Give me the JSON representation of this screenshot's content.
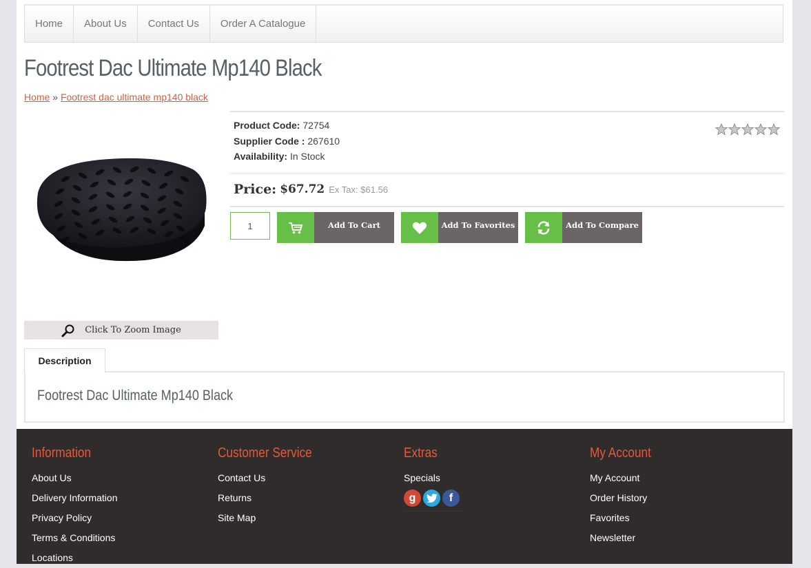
{
  "nav": {
    "items": [
      "Home",
      "About Us",
      "Contact Us",
      "Order A Catalogue"
    ]
  },
  "product": {
    "title": "Footrest Dac Ultimate Mp140 Black",
    "breadcrumb": {
      "home": "Home",
      "separator": "»",
      "current": "Footrest dac ultimate mp140 black"
    },
    "product_code_label": "Product Code:",
    "product_code": "72754",
    "supplier_code_label": "Supplier Code :",
    "supplier_code": "267610",
    "availability_label": "Availability:",
    "availability": "In Stock",
    "rating": 0,
    "rating_max": 5,
    "price_label": "Price:",
    "price": "$67.72",
    "ex_tax_label": "Ex Tax:",
    "ex_tax": "$61.56",
    "quantity": "1",
    "zoom_label": "Click To Zoom Image"
  },
  "buttons": {
    "add_to_cart": "Add To Cart",
    "add_to_favorites": "Add To Favorites",
    "add_to_compare": "Add To Compare"
  },
  "tabs": {
    "description_label": "Description",
    "description_text": "Footrest Dac Ultimate Mp140 Black"
  },
  "footer": {
    "information": {
      "title": "Information",
      "links": [
        "About Us",
        "Delivery Information",
        "Privacy Policy",
        "Terms & Conditions",
        "Locations"
      ]
    },
    "customer_service": {
      "title": "Customer Service",
      "links": [
        "Contact Us",
        "Returns",
        "Site Map"
      ]
    },
    "extras": {
      "title": "Extras",
      "links": [
        "Specials"
      ],
      "social_icons": [
        "google-plus-icon",
        "twitter-icon",
        "facebook-icon"
      ]
    },
    "my_account": {
      "title": "My Account",
      "links": [
        "My Account",
        "Order History",
        "Favorites",
        "Newsletter"
      ]
    }
  },
  "colors": {
    "accent_green": "#66c047",
    "button_gray": "#6b6565",
    "link_orange": "#e05a3c",
    "footer_bg": "#302c2c"
  }
}
